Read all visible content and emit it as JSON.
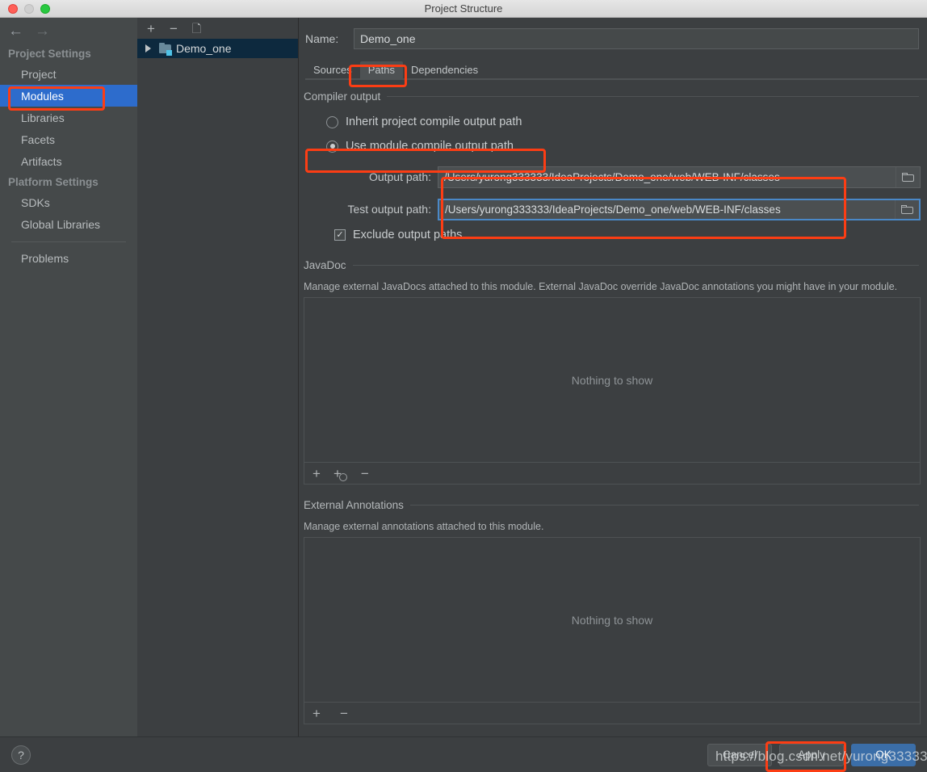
{
  "window": {
    "title": "Project Structure",
    "traffic_lights": [
      "close-red",
      "minimize-gray",
      "zoom-green"
    ]
  },
  "sidebar": {
    "back_icon": "←",
    "forward_icon": "→",
    "groups": [
      {
        "title": "Project Settings",
        "items": [
          {
            "label": "Project",
            "selected": false
          },
          {
            "label": "Modules",
            "selected": true
          },
          {
            "label": "Libraries",
            "selected": false
          },
          {
            "label": "Facets",
            "selected": false
          },
          {
            "label": "Artifacts",
            "selected": false
          }
        ]
      },
      {
        "title": "Platform Settings",
        "items": [
          {
            "label": "SDKs",
            "selected": false
          },
          {
            "label": "Global Libraries",
            "selected": false
          }
        ]
      }
    ],
    "problems_label": "Problems",
    "selected_color": "#2d6ccc"
  },
  "tree_panel": {
    "toolbar": {
      "add": "+",
      "remove": "−",
      "copy": "copy-icon"
    },
    "nodes": [
      {
        "label": "Demo_one",
        "expanded": false,
        "selected": true
      }
    ]
  },
  "module": {
    "name_label": "Name:",
    "name_value": "Demo_one",
    "tabs": [
      {
        "label": "Sources",
        "active": false
      },
      {
        "label": "Paths",
        "active": true
      },
      {
        "label": "Dependencies",
        "active": false
      }
    ],
    "compiler_output": {
      "section_title": "Compiler output",
      "options": [
        {
          "label": "Inherit project compile output path",
          "selected": false
        },
        {
          "label": "Use module compile output path",
          "selected": true
        }
      ],
      "output_path_label": "Output path:",
      "output_path_value": "/Users/yurong333333/IdeaProjects/Demo_one/web/WEB-INF/classes",
      "test_output_path_label": "Test output path:",
      "test_output_path_value": "/Users/yurong333333/IdeaProjects/Demo_one/web/WEB-INF/classes",
      "test_output_focused": true,
      "exclude_label": "Exclude output paths",
      "exclude_checked": true,
      "browse_icon": "folder-icon"
    },
    "javadoc": {
      "section_title": "JavaDoc",
      "description": "Manage external JavaDocs attached to this module. External JavaDoc override JavaDoc annotations you might have in your module.",
      "empty_text": "Nothing to show",
      "toolbar": {
        "add": "+",
        "add_url": "+",
        "remove": "−"
      }
    },
    "external_annotations": {
      "section_title": "External Annotations",
      "description": "Manage external annotations attached to this module.",
      "empty_text": "Nothing to show",
      "toolbar": {
        "add": "+",
        "remove": "−"
      }
    }
  },
  "bottom": {
    "help_label": "?",
    "cancel_label": "Cancel",
    "apply_label": "Apply",
    "ok_label": "OK"
  },
  "watermark": {
    "text": "https://blog.csdn.net/yurong33333"
  },
  "annotations": {
    "highlight_color": "#fc3d14",
    "boxes": [
      "modules-sidebar-item",
      "paths-tab",
      "use-module-compile-output-path-radio",
      "output-paths-fields",
      "apply-button"
    ]
  }
}
